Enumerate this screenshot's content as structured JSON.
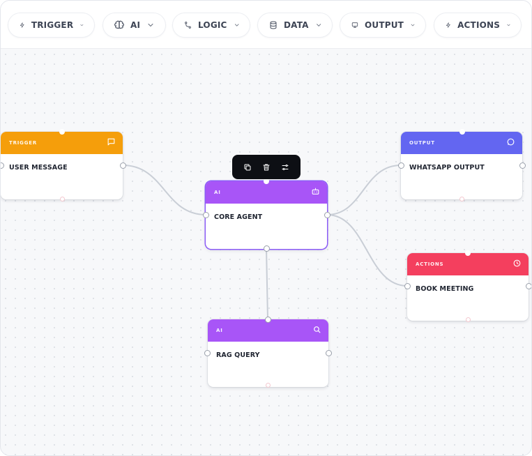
{
  "toolbar": {
    "items": [
      {
        "label": "TRIGGER",
        "icon": "bolt-icon"
      },
      {
        "label": "AI",
        "icon": "brain-icon"
      },
      {
        "label": "LOGIC",
        "icon": "branch-icon"
      },
      {
        "label": "DATA",
        "icon": "database-icon"
      },
      {
        "label": "OUTPUT",
        "icon": "monitor-icon"
      },
      {
        "label": "ACTIONS",
        "icon": "bolt-icon"
      }
    ]
  },
  "nodes": {
    "trigger": {
      "tag": "TRIGGER",
      "title": "USER MESSAGE",
      "color": "#f59e0b",
      "icon": "chat-icon"
    },
    "core": {
      "tag": "AI",
      "title": "CORE AGENT",
      "color": "#a855f7",
      "icon": "robot-icon"
    },
    "rag": {
      "tag": "AI",
      "title": "RAG QUERY",
      "color": "#a855f7",
      "icon": "search-icon"
    },
    "output": {
      "tag": "OUTPUT",
      "title": "WHATSAPP OUTPUT",
      "color": "#6366f1",
      "icon": "message-circle-icon"
    },
    "actions": {
      "tag": "ACTIONS",
      "title": "BOOK MEETING",
      "color": "#f43f5e",
      "icon": "clock-icon"
    }
  },
  "context_toolbar": {
    "buttons": [
      "copy-icon",
      "trash-icon",
      "sliders-icon"
    ]
  }
}
